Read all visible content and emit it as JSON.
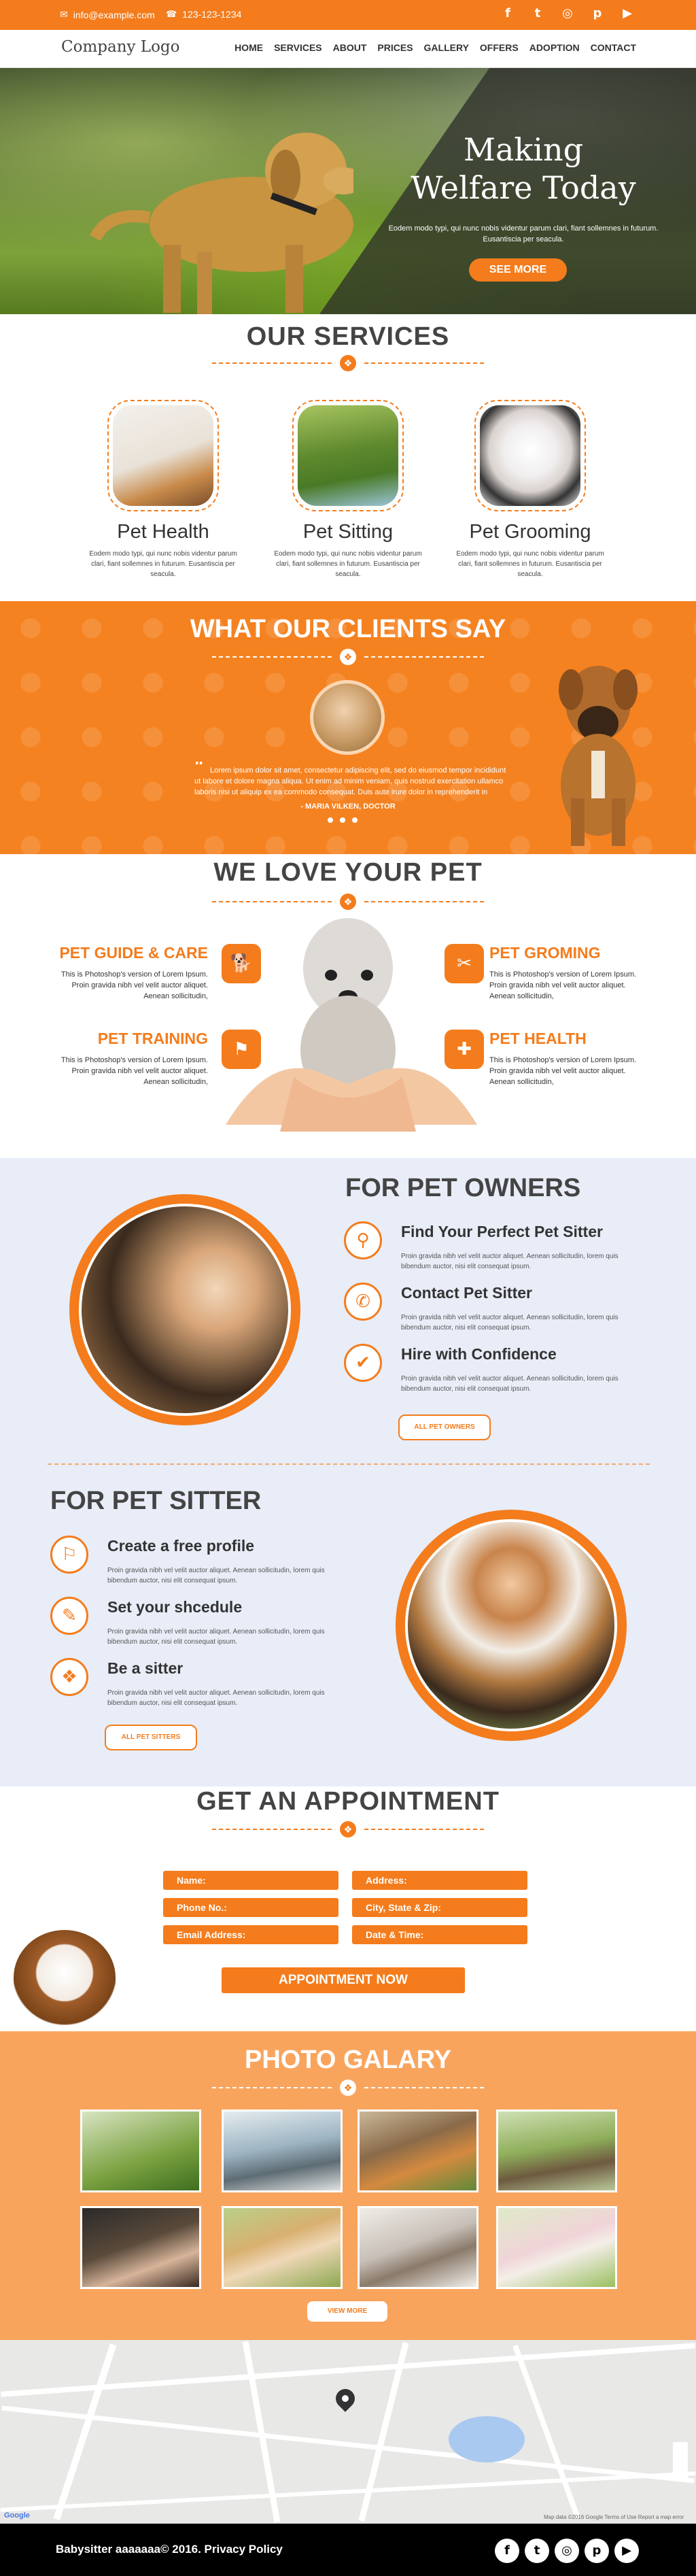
{
  "topbar": {
    "email": "info@example.com",
    "phone": "123-123-1234",
    "socials": [
      {
        "icon": "facebook-icon",
        "glyph": "f"
      },
      {
        "icon": "twitter-icon",
        "glyph": "t"
      },
      {
        "icon": "instagram-icon",
        "glyph": "◎"
      },
      {
        "icon": "pinterest-icon",
        "glyph": "p"
      },
      {
        "icon": "youtube-icon",
        "glyph": "▶"
      }
    ]
  },
  "nav": {
    "logo": "Company Logo",
    "items": [
      "HOME",
      "SERVICES",
      "ABOUT",
      "PRICES",
      "GALLERY",
      "OFFERS",
      "ADOPTION",
      "CONTACT"
    ]
  },
  "hero": {
    "title_line1": "Making",
    "title_line2": "Welfare Today",
    "text": "Eodem modo typi, qui nunc nobis videntur parum clari, fiant sollemnes in futurum. Eusantiscia per seacula.",
    "button": "SEE MORE"
  },
  "services": {
    "title": "OUR SERVICES",
    "items": [
      {
        "name": "Pet Health",
        "text": "Eodem modo typi, qui nunc nobis videntur parum clari, fiant sollemnes in futurum. Eusantiscia per seacula."
      },
      {
        "name": "Pet Sitting",
        "text": "Eodem modo typi, qui nunc nobis videntur parum clari, fiant sollemnes in futurum. Eusantiscia per seacula."
      },
      {
        "name": "Pet Grooming",
        "text": "Eodem modo typi, qui nunc nobis videntur parum clari, fiant sollemnes in futurum. Eusantiscia per seacula."
      }
    ]
  },
  "testimonial": {
    "title": "WHAT OUR CLIENTS SAY",
    "quote": "Lorem ipsum dolor sit amet, consectetur adipiscing elit, sed do eiusmod tempor incididunt ut labore et dolore magna aliqua. Ut enim ad minim veniam, quis nostrud exercitation ullamco laboris nisi ut aliquip ex ea commodo consequat. Duis aute irure dolor in reprehenderit in voluptate velit esse cillum dolore eu fugiat nulla pariatur. Excepteur sint occaecat cupidatat non proident, sunt in culpa qui officia deserunt mollit anim id est laborum.",
    "author": "- MARIA VILKEN, DOCTOR"
  },
  "love": {
    "title": "WE LOVE YOUR PET",
    "features": [
      {
        "title": "PET GUIDE & CARE",
        "text": "This is Photoshop's version of Lorem Ipsum. Proin gravida nibh vel velit auctor aliquet. Aenean sollicitudin,",
        "icon": "dog-walk-icon"
      },
      {
        "title": "PET TRAINING",
        "text": "This is Photoshop's version of Lorem Ipsum. Proin gravida nibh vel velit auctor aliquet. Aenean sollicitudin,",
        "icon": "training-icon"
      },
      {
        "title": "PET GROMING",
        "text": "This is Photoshop's version of Lorem Ipsum. Proin gravida nibh vel velit auctor aliquet. Aenean sollicitudin,",
        "icon": "scissors-icon"
      },
      {
        "title": "PET HEALTH",
        "text": "This is Photoshop's version of Lorem Ipsum. Proin gravida nibh vel velit auctor aliquet. Aenean sollicitudin,",
        "icon": "health-icon"
      }
    ]
  },
  "owners": {
    "title": "FOR PET OWNERS",
    "items": [
      {
        "title": "Find Your Perfect Pet Sitter",
        "text": "Proin gravida nibh vel velit auctor aliquet. Aenean sollicitudin, lorem quis bibendum auctor, nisi elit consequat ipsum.",
        "icon": "search-icon"
      },
      {
        "title": "Contact Pet Sitter",
        "text": "Proin gravida nibh vel velit auctor aliquet. Aenean sollicitudin, lorem quis bibendum auctor, nisi elit consequat ipsum.",
        "icon": "phone-icon"
      },
      {
        "title": "Hire with Confidence",
        "text": "Proin gravida nibh vel velit auctor aliquet. Aenean sollicitudin, lorem quis bibendum auctor, nisi elit consequat ipsum.",
        "icon": "check-icon"
      }
    ],
    "button": "ALL PET OWNERS"
  },
  "sitter": {
    "title": "FOR PET SITTER",
    "items": [
      {
        "title": "Create a free profile",
        "text": "Proin gravida nibh vel velit auctor aliquet. Aenean sollicitudin, lorem quis bibendum auctor, nisi elit consequat ipsum.",
        "icon": "profile-flag-icon"
      },
      {
        "title": "Set your shcedule",
        "text": "Proin gravida nibh vel velit auctor aliquet. Aenean sollicitudin, lorem quis bibendum auctor, nisi elit consequat ipsum.",
        "icon": "pencil-icon"
      },
      {
        "title": "Be a sitter",
        "text": "Proin gravida nibh vel velit auctor aliquet. Aenean sollicitudin, lorem quis bibendum auctor, nisi elit consequat ipsum.",
        "icon": "paw-icon"
      }
    ],
    "button": "ALL PET SITTERS"
  },
  "appointment": {
    "title": "GET AN APPOINTMENT",
    "fields": [
      "Name:",
      "Address:",
      "Phone No.:",
      "City, State & Zip:",
      "Email Address:",
      "Date & Time:"
    ],
    "button": "APPOINTMENT NOW"
  },
  "gallery": {
    "title": "PHOTO GALARY",
    "button": "VIEW MORE"
  },
  "map": {
    "attribution": "Map data ©2016 Google   Terms of Use   Report a map error",
    "google": "Google"
  },
  "footer": {
    "copyright": "Babysitter aaaaaaa© 2016. Privacy Policy"
  }
}
